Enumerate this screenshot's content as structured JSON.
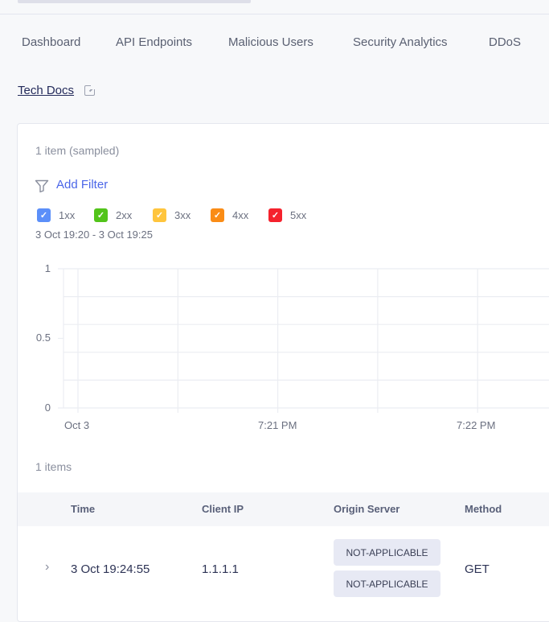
{
  "tabs": [
    "Dashboard",
    "API Endpoints",
    "Malicious Users",
    "Security Analytics",
    "DDoS"
  ],
  "tech_docs": "Tech Docs",
  "sampled": "1 item (sampled)",
  "add_filter": "Add Filter",
  "legend": [
    {
      "label": "1xx",
      "color": "#5b8ff9"
    },
    {
      "label": "2xx",
      "color": "#52c41a"
    },
    {
      "label": "3xx",
      "color": "#ffc53d"
    },
    {
      "label": "4xx",
      "color": "#fa8c16"
    },
    {
      "label": "5xx",
      "color": "#f5222d"
    }
  ],
  "range": "3 Oct 19:20 - 3 Oct 19:25",
  "chart_data": {
    "type": "line",
    "title": "",
    "xlabel": "",
    "ylabel": "",
    "ylim": [
      0,
      1
    ],
    "y_ticks": [
      "1",
      "0.5",
      "0"
    ],
    "x_ticks": [
      "Oct 3",
      "7:21 PM",
      "7:22 PM"
    ],
    "series": [],
    "grid": true
  },
  "items_count": "1 items",
  "table": {
    "headers": [
      "Time",
      "Client IP",
      "Origin Server",
      "Method"
    ],
    "rows": [
      {
        "time": "3 Oct 19:24:55",
        "client_ip": "1.1.1.1",
        "origin": [
          "NOT-APPLICABLE",
          "NOT-APPLICABLE"
        ],
        "method": "GET"
      }
    ]
  }
}
